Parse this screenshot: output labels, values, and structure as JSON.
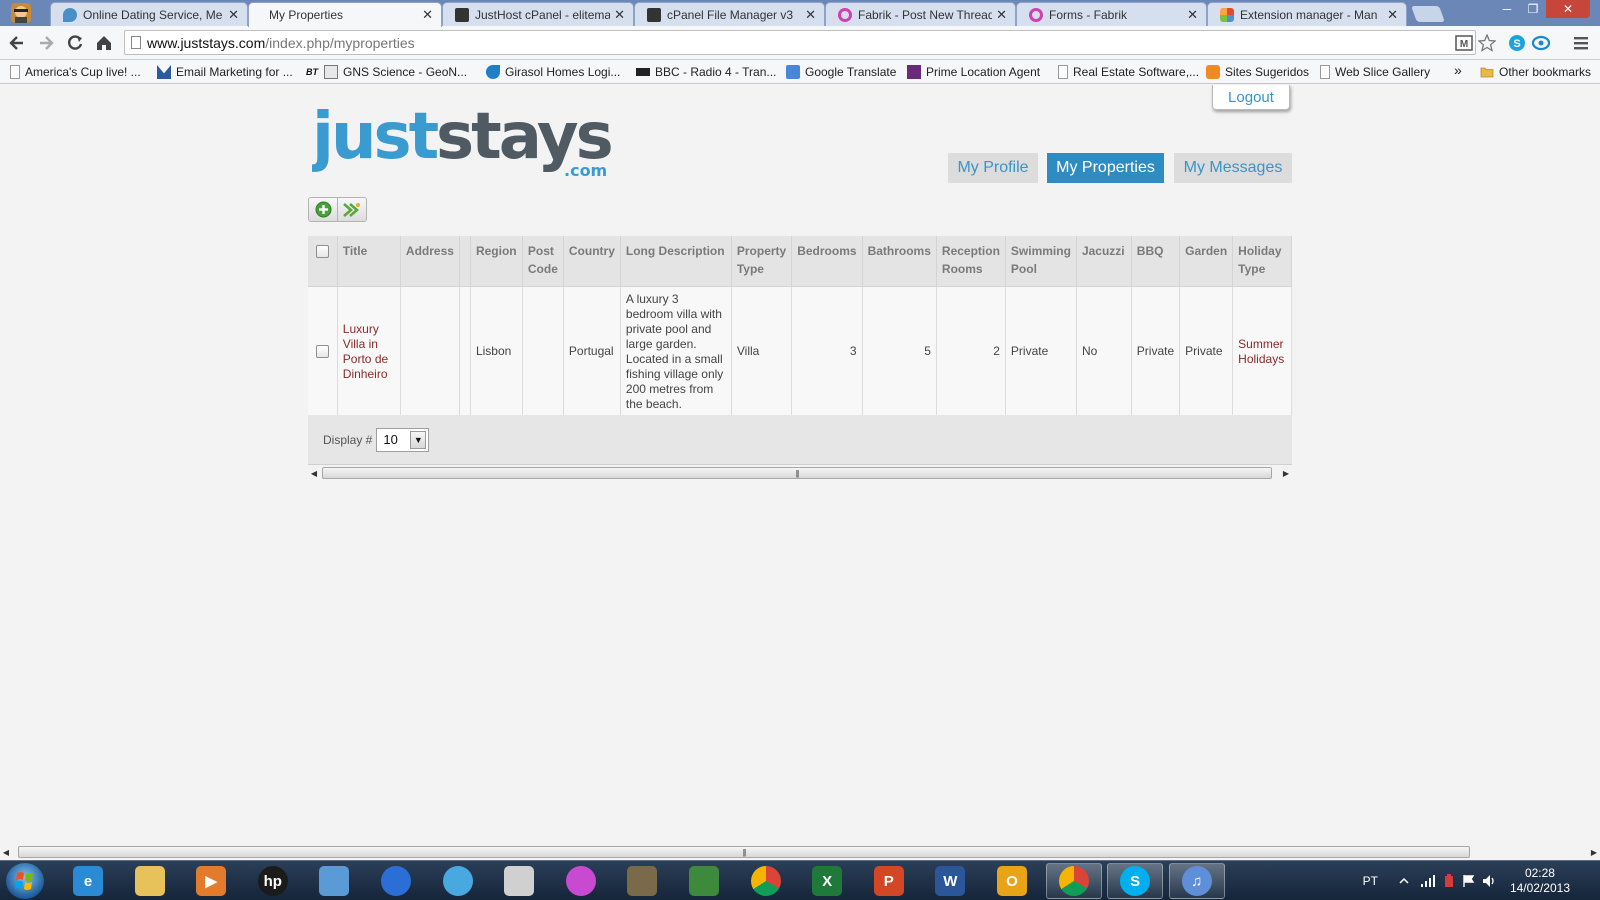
{
  "browser": {
    "tabs": [
      {
        "label": "Online Dating Service, Me",
        "icon": "dating-site-icon",
        "color": "#4a8fc7"
      },
      {
        "label": "My Properties",
        "icon": "page-icon",
        "color": "#ffffff",
        "active": true
      },
      {
        "label": "JustHost cPanel - eliteman",
        "icon": "cpanel-icon",
        "color": "#333333"
      },
      {
        "label": "cPanel File Manager v3",
        "icon": "cpanel-icon",
        "color": "#333333"
      },
      {
        "label": "Fabrik - Post New Thread",
        "icon": "fabrik-icon",
        "color": "#d23fb0"
      },
      {
        "label": "Forms - Fabrik",
        "icon": "fabrik-icon",
        "color": "#d23fb0"
      },
      {
        "label": "Extension manager - Man",
        "icon": "joomla-icon",
        "color": "#e04a2f"
      }
    ],
    "close_glyph": "✕",
    "url_host": "www.juststays.com",
    "url_path": "/index.php/myproperties",
    "bookmarks": [
      {
        "label": "America's Cup live! ...",
        "icon": "page-icon"
      },
      {
        "label": "Email Marketing for ...",
        "icon": "email-marketing-icon"
      },
      {
        "label": "GNS Science - GeoN...",
        "icon": "gns-icon"
      },
      {
        "label": "Girasol Homes Logi...",
        "icon": "girasol-icon"
      },
      {
        "label": "BBC - Radio 4 - Tran...",
        "icon": "bbc-icon"
      },
      {
        "label": "Google Translate",
        "icon": "translate-icon"
      },
      {
        "label": "Prime Location Agent",
        "icon": "zoopla-icon"
      },
      {
        "label": "Real Estate Software,...",
        "icon": "page-icon"
      },
      {
        "label": "Sites Sugeridos",
        "icon": "suggested-sites-icon"
      },
      {
        "label": "Web Slice Gallery",
        "icon": "page-icon"
      }
    ],
    "bookmarks_overflow": "»",
    "other_bookmarks": "Other bookmarks",
    "bt_badge": "BT"
  },
  "site": {
    "logo_just": "just",
    "logo_stays": "stays",
    "logo_com": ".com",
    "logout": "Logout",
    "nav": [
      {
        "label": "My Profile",
        "active": false
      },
      {
        "label": "My Properties",
        "active": true
      },
      {
        "label": "My Messages",
        "active": false
      }
    ],
    "colors": {
      "accent": "#2f8cc2",
      "logo_blue": "#3a9bd0",
      "logo_grey": "#505a63",
      "link": "#8a2a2a",
      "add_green": "#48a23a"
    }
  },
  "grid": {
    "headers": [
      {
        "key": "select",
        "label": "",
        "checkbox": true
      },
      {
        "key": "title",
        "label": "Title"
      },
      {
        "key": "address",
        "label": "Address"
      },
      {
        "key": "blank",
        "label": ""
      },
      {
        "key": "region",
        "label": "Region"
      },
      {
        "key": "postcode",
        "label": "Post Code"
      },
      {
        "key": "country",
        "label": "Country"
      },
      {
        "key": "longdesc",
        "label": "Long Description"
      },
      {
        "key": "proptype",
        "label": "Property Type"
      },
      {
        "key": "bedrooms",
        "label": "Bedrooms"
      },
      {
        "key": "bathrooms",
        "label": "Bathrooms"
      },
      {
        "key": "reception",
        "label": "Reception Rooms"
      },
      {
        "key": "pool",
        "label": "Swimming Pool"
      },
      {
        "key": "jacuzzi",
        "label": "Jacuzzi"
      },
      {
        "key": "bbq",
        "label": "BBQ"
      },
      {
        "key": "garden",
        "label": "Garden"
      },
      {
        "key": "holiday",
        "label": "Holiday Type"
      }
    ],
    "rows": [
      {
        "title": "Luxury Villa in Porto de Dinheiro",
        "address": "",
        "blank": "",
        "region": "Lisbon",
        "postcode": "",
        "country": "Portugal",
        "longdesc": "A luxury 3 bedroom villa with private pool and large garden. Located in a small fishing village only 200 metres from the beach.",
        "proptype": "Villa",
        "bedrooms": "3",
        "bathrooms": "5",
        "reception": "2",
        "pool": "Private",
        "jacuzzi": "No",
        "bbq": "Private",
        "garden": "Private",
        "holiday": "Summer Holidays"
      }
    ],
    "display_label": "Display #",
    "display_value": "10"
  },
  "taskbar": {
    "apps": [
      {
        "name": "internet-explorer-icon",
        "label": "e",
        "color": "#2a8ad4"
      },
      {
        "name": "file-explorer-icon",
        "label": "",
        "color": "#e7c25a"
      },
      {
        "name": "media-player-icon",
        "label": "▶",
        "color": "#e47a2b"
      },
      {
        "name": "hp-icon",
        "label": "hp",
        "color": "#1b1b1b"
      },
      {
        "name": "3d-box-icon",
        "label": "",
        "color": "#5a9ad6"
      },
      {
        "name": "globe-icon",
        "label": "",
        "color": "#2b6fd6"
      },
      {
        "name": "spiral-app-icon",
        "label": "",
        "color": "#4aa8e0"
      },
      {
        "name": "document-viewer-icon",
        "label": "",
        "color": "#d0d0d0"
      },
      {
        "name": "picasa-icon",
        "label": "",
        "color": "#c84ad0"
      },
      {
        "name": "gimp-icon",
        "label": "",
        "color": "#7a6a4a"
      },
      {
        "name": "spreadsheet-icon",
        "label": "",
        "color": "#3d8a3d"
      },
      {
        "name": "chrome-icon",
        "label": "",
        "color": "#d9432f"
      },
      {
        "name": "excel-icon",
        "label": "X",
        "color": "#1f7a3a"
      },
      {
        "name": "powerpoint-icon",
        "label": "P",
        "color": "#d24726"
      },
      {
        "name": "word-icon",
        "label": "W",
        "color": "#2b579a"
      },
      {
        "name": "outlook-icon",
        "label": "O",
        "color": "#e8a317"
      },
      {
        "name": "chrome-running-icon",
        "label": "",
        "color": "#d9432f"
      },
      {
        "name": "skype-icon",
        "label": "S",
        "color": "#00aff0"
      },
      {
        "name": "itunes-icon",
        "label": "♫",
        "color": "#5f8fd8"
      }
    ],
    "language": "PT",
    "time": "02:28",
    "date": "14/02/2013"
  }
}
